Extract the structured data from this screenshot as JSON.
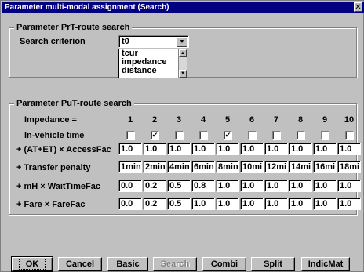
{
  "window": {
    "title": "Parameter multi-modal assignment (Search)",
    "close_glyph": "✕"
  },
  "prt": {
    "group_label": "Parameter  PrT-route search",
    "criterion_label": "Search criterion",
    "criterion_value": "t0",
    "options": [
      "tcur",
      "impedance",
      "distance"
    ]
  },
  "put": {
    "group_label": "Parameter  PuT-route search",
    "impedance_label": "Impedance =",
    "columns": [
      "1",
      "2",
      "3",
      "4",
      "5",
      "6",
      "7",
      "8",
      "9",
      "10"
    ],
    "invehicle_label": "In-vehicle time",
    "invehicle_checked": [
      false,
      true,
      false,
      false,
      true,
      false,
      false,
      false,
      false,
      false
    ],
    "rows": [
      {
        "label": "+ (AT+ET) × AccessFac",
        "values": [
          "1.0",
          "1.0",
          "1.0",
          "1.0",
          "1.0",
          "1.0",
          "1.0",
          "1.0",
          "1.0",
          "1.0"
        ]
      },
      {
        "label": "+ Transfer penalty",
        "values": [
          "1min",
          "2min",
          "4min",
          "6min",
          "8min",
          "10mi",
          "12mi",
          "14mi",
          "16mi",
          "18mi"
        ]
      },
      {
        "label": "+ mH × WaitTimeFac",
        "values": [
          "0.0",
          "0.2",
          "0.5",
          "0.8",
          "1.0",
          "1.0",
          "1.0",
          "1.0",
          "1.0",
          "1.0"
        ]
      },
      {
        "label": "+ Fare × FareFac",
        "values": [
          "0.0",
          "0.2",
          "0.5",
          "1.0",
          "1.0",
          "1.0",
          "1.0",
          "1.0",
          "1.0",
          "1.0"
        ]
      }
    ]
  },
  "buttons": {
    "ok": "OK",
    "cancel": "Cancel",
    "basic": "Basic",
    "search": "Search",
    "combi": "Combi",
    "split": "Split",
    "indicmat": "IndicMat"
  },
  "icons": {
    "dropdown": "chevron-down-icon",
    "scroll_up": "arrow-up-icon",
    "scroll_down": "arrow-down-icon",
    "check": "✔"
  }
}
